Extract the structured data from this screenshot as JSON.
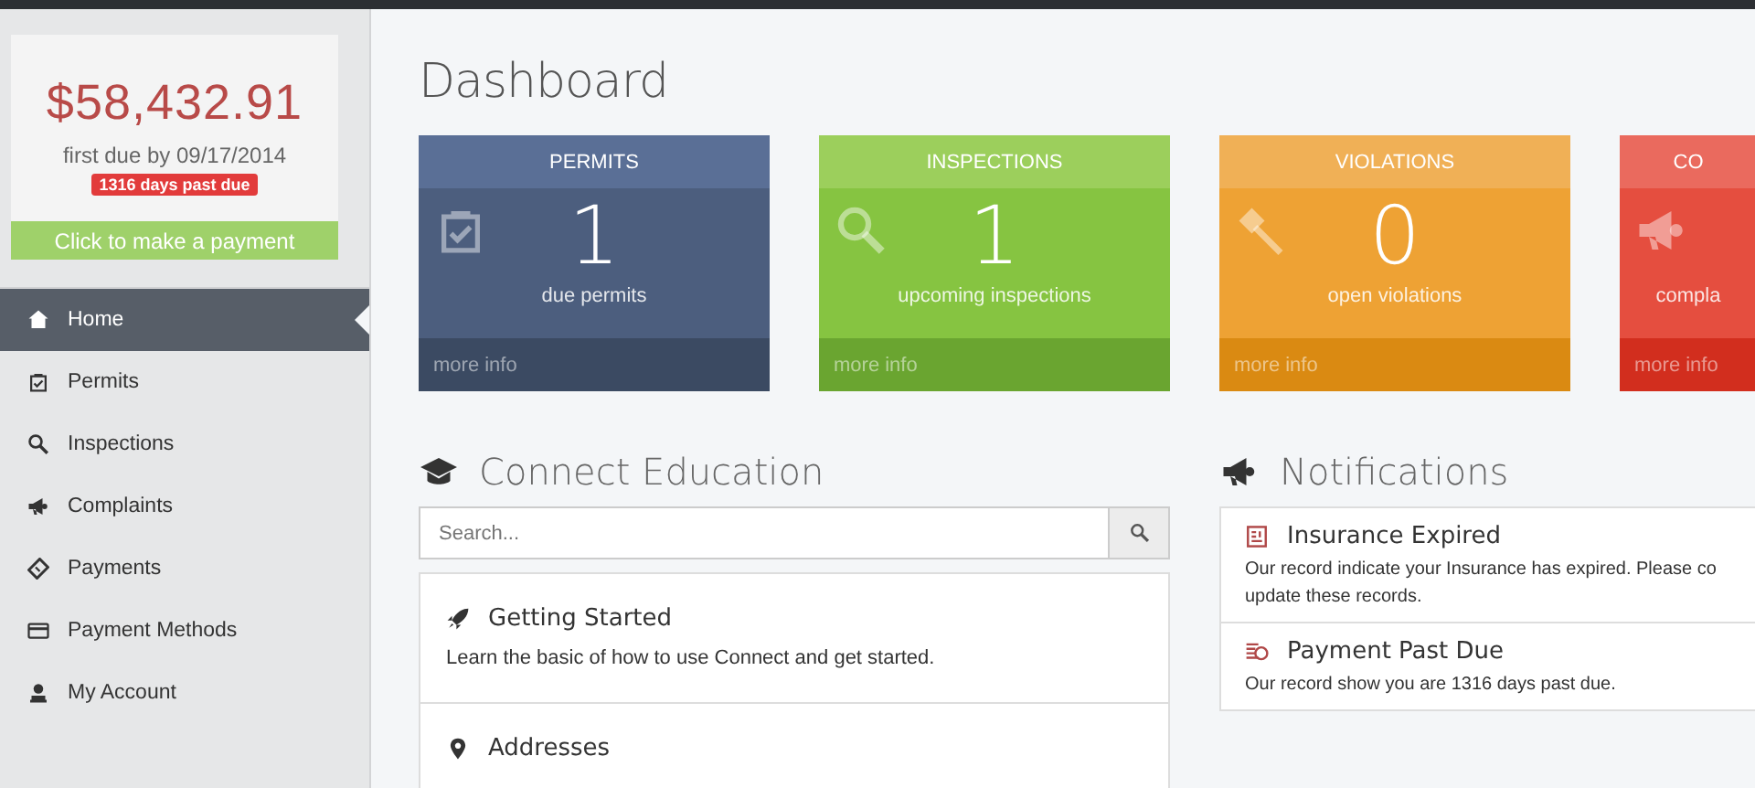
{
  "balance": {
    "amount": "$58,432.91",
    "due_text": "first due by 09/17/2014",
    "badge": "1316 days past due",
    "button": "Click to make a payment"
  },
  "nav": [
    {
      "label": "Home",
      "selected": true
    },
    {
      "label": "Permits",
      "selected": false
    },
    {
      "label": "Inspections",
      "selected": false
    },
    {
      "label": "Complaints",
      "selected": false
    },
    {
      "label": "Payments",
      "selected": false
    },
    {
      "label": "Payment Methods",
      "selected": false
    },
    {
      "label": "My Account",
      "selected": false
    }
  ],
  "page_title": "Dashboard",
  "stat_cards": [
    {
      "kind": "blue",
      "title": "PERMITS",
      "value": "1",
      "caption": "due permits",
      "link": "more info"
    },
    {
      "kind": "green",
      "title": "INSPECTIONS",
      "value": "1",
      "caption": "upcoming inspections",
      "link": "more info"
    },
    {
      "kind": "orange",
      "title": "VIOLATIONS",
      "value": "0",
      "caption": "open violations",
      "link": "more info"
    },
    {
      "kind": "red",
      "title": "CO",
      "caption": "compla",
      "link": "more info"
    }
  ],
  "education": {
    "title": "Connect Education",
    "search_placeholder": "Search...",
    "items": [
      {
        "title": "Getting Started",
        "description": "Learn the basic of how to use Connect and get started."
      },
      {
        "title": "Addresses"
      }
    ]
  },
  "notifications": {
    "title": "Notifications",
    "items": [
      {
        "title": "Insurance Expired",
        "lines": [
          "Our record indicate your Insurance has expired. Please co",
          "update these records."
        ]
      },
      {
        "title": "Payment Past Due",
        "lines": [
          "Our record show you are 1316 days past due."
        ]
      }
    ]
  }
}
